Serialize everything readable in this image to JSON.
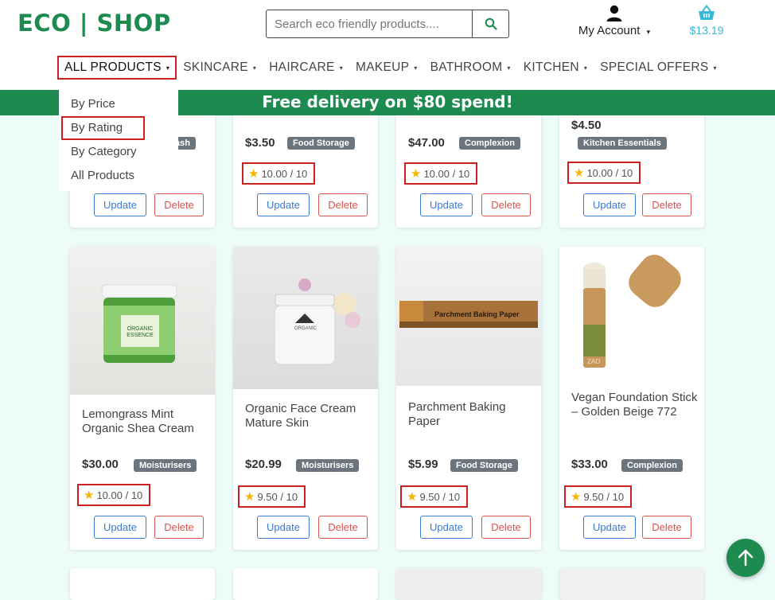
{
  "header": {
    "logo": "ECO | SHOP",
    "search_placeholder": "Search eco friendly products....",
    "account_label": "My Account",
    "account_caret": "▾",
    "cart_total": "$13.19"
  },
  "nav": {
    "items": [
      {
        "label": "ALL PRODUCTS"
      },
      {
        "label": "SKINCARE"
      },
      {
        "label": "HAIRCARE"
      },
      {
        "label": "MAKEUP"
      },
      {
        "label": "BATHROOM"
      },
      {
        "label": "KITCHEN"
      },
      {
        "label": "SPECIAL OFFERS"
      }
    ],
    "caret": "▾"
  },
  "dropdown": {
    "options": [
      "By Price",
      "By Rating",
      "By Category",
      "All Products"
    ]
  },
  "banner": "Free delivery on $80 spend!",
  "buttons": {
    "update": "Update",
    "delete": "Delete"
  },
  "top_row": [
    {
      "price": "",
      "category": "ash",
      "rating": ""
    },
    {
      "price": "$3.50",
      "category": "Food Storage",
      "rating": "10.00 / 10"
    },
    {
      "price": "$47.00",
      "category": "Complexion",
      "rating": "10.00 / 10"
    },
    {
      "price": "$4.50",
      "category": "Kitchen Essentials",
      "rating": "10.00 / 10"
    }
  ],
  "products": [
    {
      "name": "Lemongrass Mint Organic Shea Cream",
      "price": "$30.00",
      "category": "Moisturisers",
      "rating": "10.00 / 10",
      "image_text": "ORGANIC ESSENCE"
    },
    {
      "name": "Organic Face Cream Mature Skin",
      "price": "$20.99",
      "category": "Moisturisers",
      "rating": "9.50 / 10",
      "image_text": "ORGANIC"
    },
    {
      "name": "Parchment Baking Paper",
      "price": "$5.99",
      "category": "Food Storage",
      "rating": "9.50 / 10",
      "image_text": "Parchment Baking Paper"
    },
    {
      "name": "Vegan Foundation Stick – Golden Beige 772",
      "price": "$33.00",
      "category": "Complexion",
      "rating": "9.50 / 10",
      "image_text": "ZAO"
    }
  ],
  "colors": {
    "brand": "#1d8a4f",
    "accent": "#35b8d9",
    "highlight": "#cc1f1f",
    "rating_star": "#f2b600"
  }
}
